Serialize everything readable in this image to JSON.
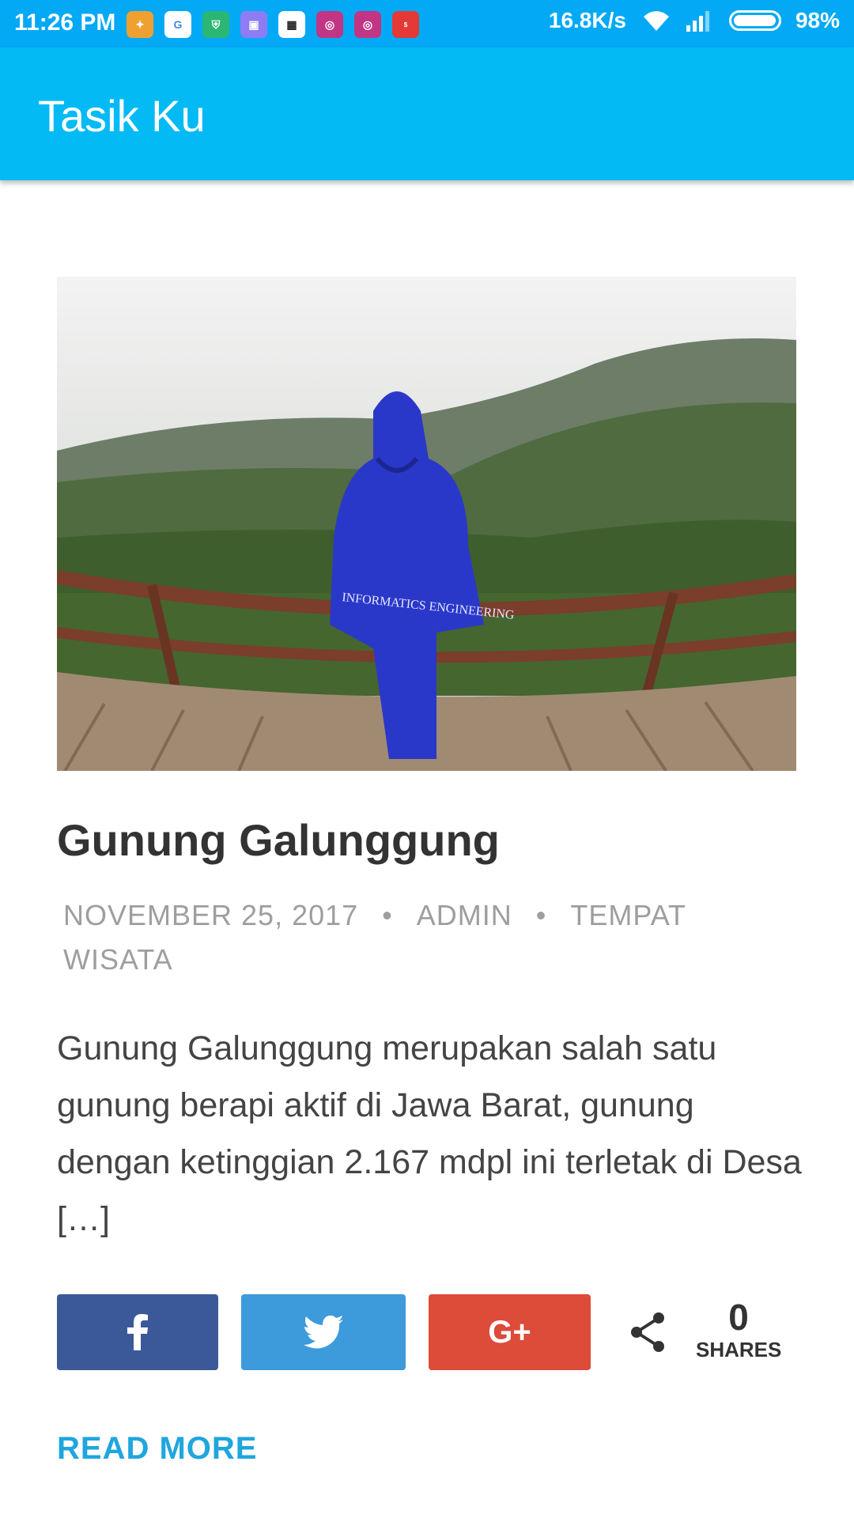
{
  "status_bar": {
    "time": "11:26 PM",
    "network_speed": "16.8K/s",
    "battery": "98%",
    "app_icons": [
      {
        "name": "app-notification-icon",
        "color": "#F0A030"
      },
      {
        "name": "google-icon",
        "color": "#ffffff"
      },
      {
        "name": "shield-app-icon",
        "color": "#2BB673"
      },
      {
        "name": "app-icon",
        "color": "#8E7CF5"
      },
      {
        "name": "bbm-icon",
        "color": "#ffffff"
      },
      {
        "name": "instagram-icon",
        "color": "#C13584"
      },
      {
        "name": "instagram-icon",
        "color": "#C13584"
      },
      {
        "name": "money-lover-icon",
        "color": "#E53935"
      }
    ]
  },
  "app_bar": {
    "title": "Tasik Ku",
    "color": "#03BAF4"
  },
  "post": {
    "title": "Gunung Galunggung",
    "meta": {
      "date": "NOVEMBER 25, 2017",
      "author": "ADMIN",
      "category": "TEMPAT WISATA",
      "separator": "•"
    },
    "excerpt": "Gunung Galunggung merupakan salah satu gunung berapi aktif di Jawa Barat, gunung dengan ketinggian 2.167 mdpl ini terletak di Desa […]",
    "image_jacket_text": "INFORMATICS ENGINEERING"
  },
  "share": {
    "facebook_color": "#3B5998",
    "twitter_color": "#3D9ADB",
    "googleplus_color": "#DD4B39",
    "googleplus_label": "G+",
    "count": "0",
    "count_label": "SHARES"
  },
  "read_more": "READ MORE"
}
